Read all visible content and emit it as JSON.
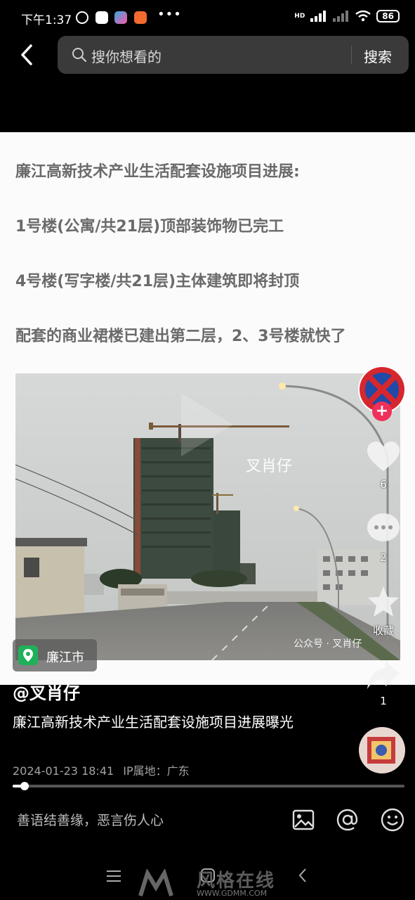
{
  "status_bar": {
    "time": "下午1:37",
    "dots": "•••",
    "net_label": "HD",
    "battery": "86"
  },
  "search": {
    "placeholder": "搜你想看的",
    "button": "搜索"
  },
  "article": {
    "title": "廉江高新技术产业生活配套设施项目进展:",
    "lines": [
      "1号楼(公寓/共21层)顶部装饰物已完工",
      "4号楼(写字楼/共21层)主体建筑即将封顶",
      "配套的商业裙楼已建出第二层，2、3号楼就快了"
    ]
  },
  "photo": {
    "watermark": "叉肖仔",
    "gzh_label": "公众号 · 叉肖仔",
    "sign_text": ""
  },
  "location": {
    "label": "廉江市"
  },
  "rail": {
    "likes": "6",
    "comments": "2",
    "favorite_label": "收藏",
    "shares": "1"
  },
  "post": {
    "author": "@叉肖仔",
    "description": "廉江高新技术产业生活配套设施项目进展曝光",
    "date": "2024-01-23 18:41",
    "ip": "IP属地：广东",
    "progress": 0.03
  },
  "comment_bar": {
    "placeholder": "善语结善缘，恶言伤人心"
  },
  "watermark_brand": {
    "name": "风格在线",
    "url": "WWW.GDMM.COM"
  },
  "colors": {
    "location_pin": "#1fb15a",
    "follow_plus": "#f0305a",
    "article_text": "#6a6a6a"
  }
}
